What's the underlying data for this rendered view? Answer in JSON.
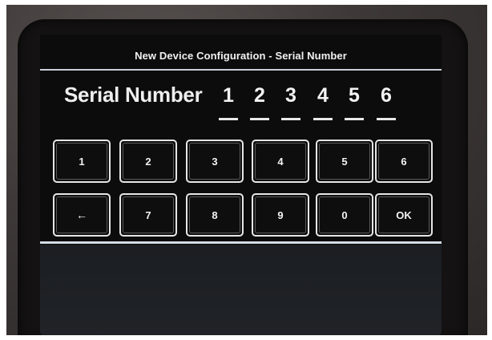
{
  "screen": {
    "title": "New Device Configuration  -  Serial Number"
  },
  "serial": {
    "label": "Serial Number",
    "digits": [
      "1",
      "2",
      "3",
      "4",
      "5",
      "6"
    ]
  },
  "keypad": {
    "row1": [
      "1",
      "2",
      "3",
      "4",
      "5",
      "6"
    ],
    "row2": [
      "←",
      "7",
      "8",
      "9",
      "0",
      "OK"
    ]
  },
  "colors": {
    "screen_background": "#0c0c0d",
    "text": "#f1f1f1",
    "key_border": "#e6e6e6",
    "rule": "#c9d0d6"
  }
}
